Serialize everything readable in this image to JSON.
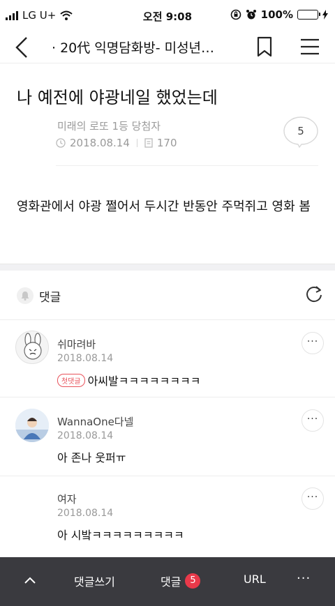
{
  "status_bar": {
    "carrier": "LG U+",
    "time": "오전 9:08",
    "battery": "100%"
  },
  "nav": {
    "title": "· 20代 익명담화방- 미성년…",
    "icons": [
      "back-chevron-icon",
      "bookmark-icon",
      "menu-icon"
    ]
  },
  "post": {
    "title": "나 예전에 야광네일 했었는데",
    "author": "미래의 로또 1등 당첨자",
    "date": "2018.08.14",
    "views": "170",
    "comment_count": "5",
    "body": "영화관에서 야광 쩔어서 두시간 반동안 주먹쥐고 영화 봄"
  },
  "comments_section": {
    "label": "댓글",
    "comments": [
      {
        "name": "쉬마려바",
        "date": "2018.08.14",
        "badge": "첫댓글",
        "text": "아씨발ㅋㅋㅋㅋㅋㅋㅋㅋ",
        "more": "···"
      },
      {
        "name": "WannaOne다넬",
        "date": "2018.08.14",
        "text": "아 존나 웃퍼ㅠ",
        "more": "···"
      },
      {
        "name": "여자",
        "date": "2018.08.14",
        "text": "아 시밬ㅋㅋㅋㅋㅋㅋㅋㅋㅋ",
        "more": "···"
      }
    ]
  },
  "bottom_bar": {
    "write_label": "댓글쓰기",
    "comments_label": "댓글",
    "comments_count": "5",
    "url_label": "URL",
    "more_label": "···"
  },
  "colors": {
    "accent_red": "#e8394a",
    "bottom_bar_bg": "#3a3a3f",
    "battery_green": "#3ec94a"
  }
}
